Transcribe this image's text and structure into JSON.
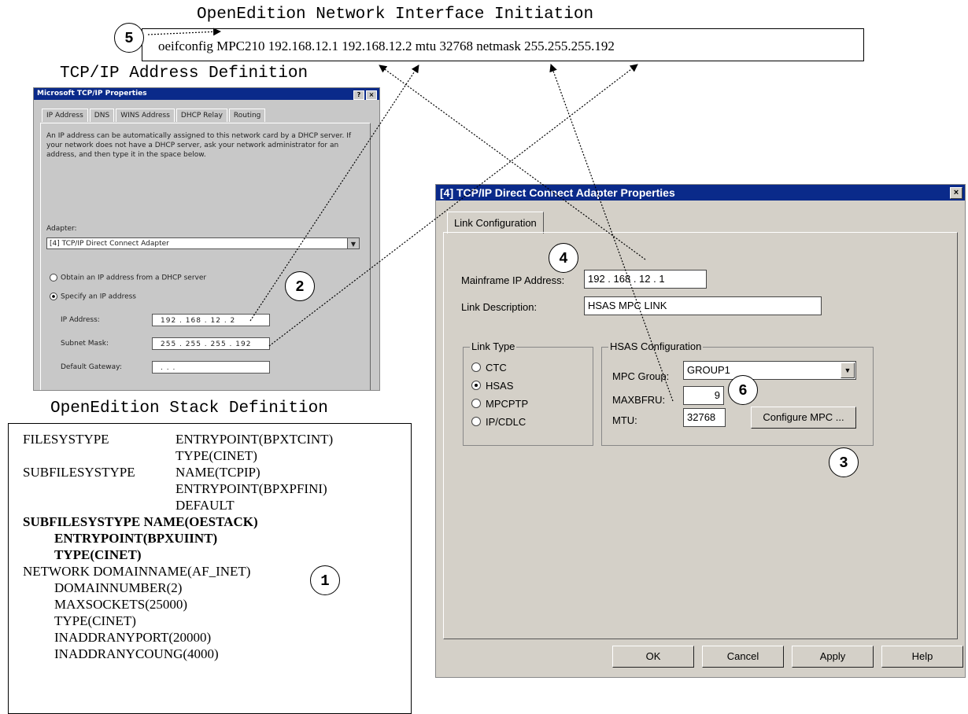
{
  "headings": {
    "network_interface": "OpenEdition Network Interface Initiation",
    "tcpip_address": "TCP/IP Address Definition",
    "stack_definition": "OpenEdition Stack Definition"
  },
  "command": "oeifconfig MPC210 192.168.12.1 192.168.12.2  mtu 32768 netmask 255.255.255.192",
  "callouts": [
    "1",
    "2",
    "3",
    "4",
    "5",
    "6"
  ],
  "small_dialog": {
    "title": "Microsoft TCP/IP Properties",
    "title_buttons": [
      "?",
      "×"
    ],
    "tabs": [
      "IP Address",
      "DNS",
      "WINS Address",
      "DHCP Relay",
      "Routing"
    ],
    "description": "An IP address can be automatically assigned to this network card by a DHCP server.  If your network does not have a DHCP server, ask your network administrator for an address, and then type it in the space below.",
    "adapter_label": "Adapter:",
    "adapter_value": "[4] TCP/IP Direct Connect Adapter",
    "radio_dhcp": "Obtain an IP address from a DHCP server",
    "radio_specify": "Specify an IP address",
    "ip_label": "IP Address:",
    "ip_value": "192 . 168 . 12 . 2",
    "subnet_label": "Subnet Mask:",
    "subnet_value": "255 . 255 . 255 . 192",
    "gateway_label": "Default Gateway:",
    "gateway_value": "   .     .     ."
  },
  "stack": {
    "lines": [
      {
        "left": "FILESYSTYPE",
        "right": "ENTRYPOINT(BPXTCINT)"
      },
      {
        "left": "",
        "right": "TYPE(CINET)"
      },
      {
        "left": "SUBFILESYSTYPE",
        "right": "NAME(TCPIP)"
      },
      {
        "left": "",
        "right": "ENTRYPOINT(BPXPFINI)"
      },
      {
        "left": "",
        "right": "DEFAULT"
      }
    ],
    "bold_lines": [
      "SUBFILESYSTYPE  NAME(OESTACK)",
      "ENTRYPOINT(BPXUIINT)",
      "TYPE(CINET)"
    ],
    "network_lines": [
      "NETWORK  DOMAINNAME(AF_INET)",
      "DOMAINNUMBER(2)",
      "MAXSOCKETS(25000)",
      "TYPE(CINET)",
      "INADDRANYPORT(20000)",
      "INADDRANYCOUNG(4000)"
    ]
  },
  "dialog": {
    "title": "[4] TCP/IP Direct Connect Adapter Properties",
    "close": "×",
    "tab": "Link Configuration",
    "mainframe_ip_label": "Mainframe IP Address:",
    "mainframe_ip_value": "192 . 168 . 12 . 1",
    "link_desc_label": "Link Description:",
    "link_desc_value": "HSAS MPC LINK",
    "link_type": {
      "legend": "Link Type",
      "options": [
        "CTC",
        "HSAS",
        "MPCPTP",
        "IP/CDLC"
      ],
      "selected": "HSAS"
    },
    "hsas": {
      "legend": "HSAS Configuration",
      "mpc_group_label": "MPC Group:",
      "mpc_group_value": "GROUP1",
      "maxbfru_label": "MAXBFRU:",
      "maxbfru_value": "9",
      "mtu_label": "MTU:",
      "mtu_value": "32768",
      "configure_button": "Configure MPC ..."
    },
    "buttons": {
      "ok": "OK",
      "cancel": "Cancel",
      "apply": "Apply",
      "help": "Help"
    }
  }
}
